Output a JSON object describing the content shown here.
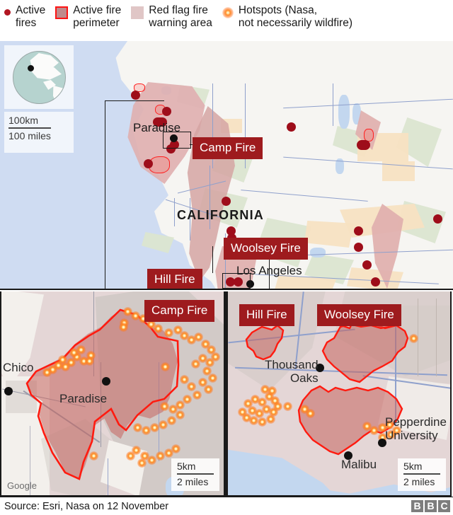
{
  "legend": {
    "items": [
      {
        "icon": "active-fire-dot-icon",
        "label": "Active\nfires",
        "color": "#b21622"
      },
      {
        "icon": "active-fire-perimeter-swatch-icon",
        "label": "Active fire\nperimeter",
        "color": "#c08b8c",
        "outline": "#ff1414"
      },
      {
        "icon": "red-flag-warning-swatch-icon",
        "label": "Red flag fire\nwarning area",
        "color": "#e0c6c6"
      },
      {
        "icon": "hotspot-glow-icon",
        "label": "Hotspots (Nasa,\nnot necessarily wildfire)",
        "color": "#ff8a2b"
      }
    ]
  },
  "main_map": {
    "state_label": "CALIFORNIA",
    "place_labels": [
      {
        "name": "Paradise"
      },
      {
        "name": "Los Angeles"
      }
    ],
    "fire_tags": [
      {
        "name": "Camp Fire"
      },
      {
        "name": "Woolsey Fire"
      },
      {
        "name": "Hill Fire"
      }
    ],
    "scale": {
      "metric": "100km",
      "imperial": "100 miles"
    }
  },
  "inset_left": {
    "fire_tag": "Camp Fire",
    "places": [
      {
        "name": "Chico"
      },
      {
        "name": "Paradise"
      }
    ],
    "scale": {
      "metric": "5km",
      "imperial": "2 miles"
    },
    "attribution": "Google"
  },
  "inset_right": {
    "fire_tags": [
      {
        "name": "Hill Fire"
      },
      {
        "name": "Woolsey Fire"
      }
    ],
    "places": [
      {
        "name": "Thousand\nOaks"
      },
      {
        "name": "Pepperdine\nUniversity"
      },
      {
        "name": "Malibu"
      }
    ],
    "scale": {
      "metric": "5km",
      "imperial": "2 miles"
    }
  },
  "footer": {
    "source": "Source: Esri, Nasa on 12 November",
    "brand": [
      "B",
      "B",
      "C"
    ]
  }
}
